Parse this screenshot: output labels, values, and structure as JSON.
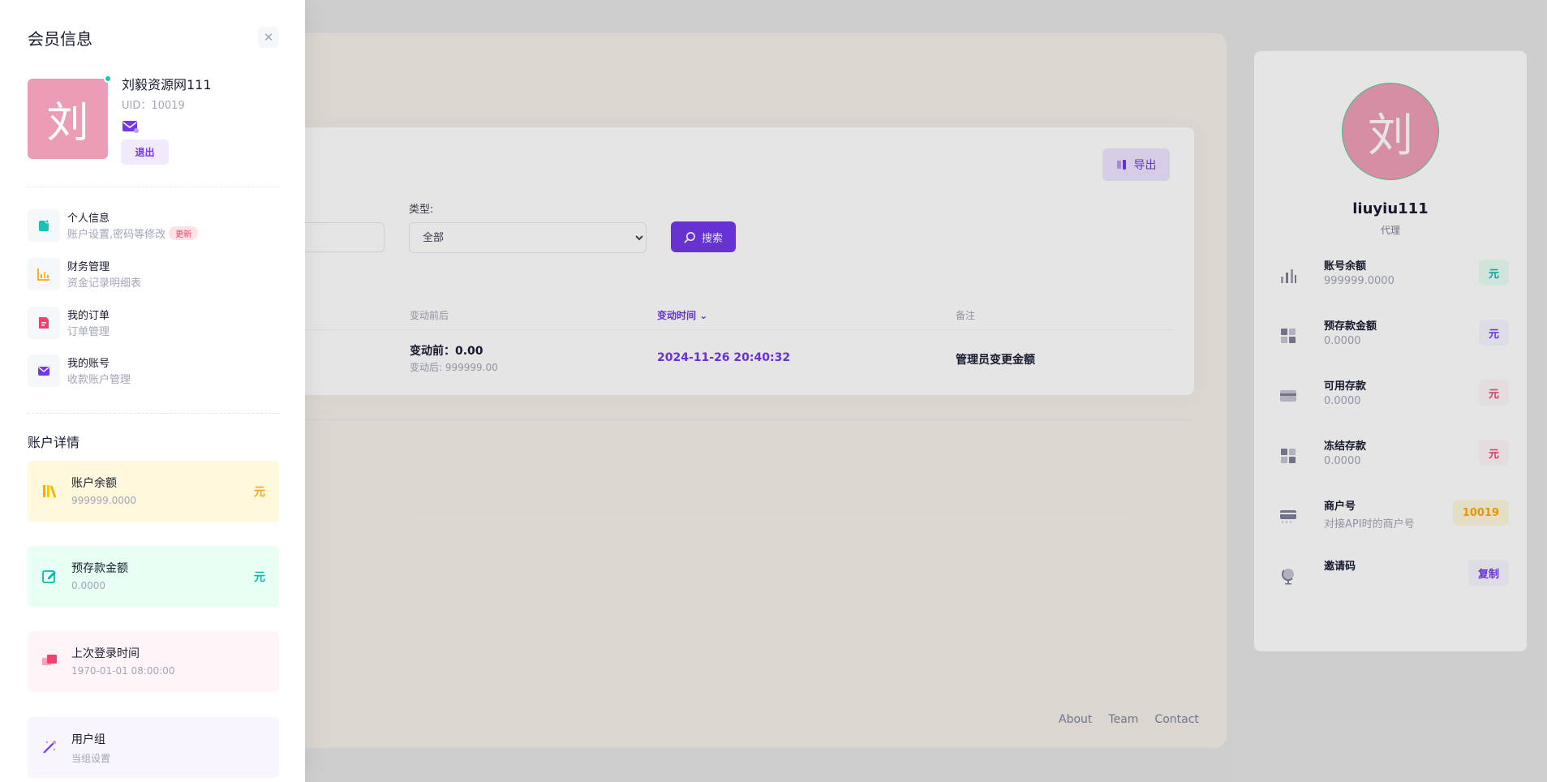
{
  "background": {
    "export_label": "导出",
    "type_label": "类型:",
    "type_selected": "全部",
    "search_label": "搜索",
    "table": {
      "headers": [
        "变动前后",
        "变动时间",
        "备注"
      ],
      "row": {
        "before_main": "变动前：0.00",
        "before_sub": "变动后: 999999.00",
        "time": "2024-11-26 20:40:32",
        "note": "管理员变更金额"
      }
    },
    "footer_links": [
      "About",
      "Team",
      "Contact"
    ]
  },
  "right_panel": {
    "avatar_char": "刘",
    "name": "liuyiu111",
    "role": "代理",
    "items": [
      {
        "title": "账号余额",
        "sub": "999999.0000",
        "badge": "元",
        "icon": "bar-chart-icon"
      },
      {
        "title": "预存款金额",
        "sub": "0.0000",
        "badge": "元",
        "icon": "grid-icon"
      },
      {
        "title": "可用存款",
        "sub": "0.0000",
        "badge": "元",
        "icon": "credit-card-icon"
      },
      {
        "title": "冻结存款",
        "sub": "0.0000",
        "badge": "元",
        "icon": "grid-icon"
      },
      {
        "title": "商户号",
        "sub": "对接API时的商户号",
        "badge": "10019",
        "icon": "card-icon"
      },
      {
        "title": "邀请码",
        "sub": "",
        "badge": "复制",
        "icon": "globe-icon"
      }
    ],
    "colors": {
      "teal_bg": "#e8fff3",
      "teal_fg": "#0bb7af",
      "purple_bg": "#f8f5ff",
      "purple_fg": "#7239ea",
      "red_bg": "#fff5f8",
      "red_fg": "#f1416c",
      "orange_bg": "#fff8dd",
      "orange_fg": "#ffa800"
    }
  },
  "drawer": {
    "title": "会员信息",
    "avatar_char": "刘",
    "username": "刘毅资源网111",
    "uid": "UID：10019",
    "logout_label": "退出",
    "menu": [
      {
        "title": "个人信息",
        "sub": "账户设置,密码等修改",
        "badge": "更新",
        "icon": "profile-icon"
      },
      {
        "title": "财务管理",
        "sub": "资金记录明细表",
        "icon": "chart-icon"
      },
      {
        "title": "我的订单",
        "sub": "订单管理",
        "icon": "order-icon"
      },
      {
        "title": "我的账号",
        "sub": "收款账户管理",
        "icon": "mail-icon"
      }
    ],
    "section_title": "账户详情",
    "stats": [
      {
        "title": "账户余额",
        "sub": "999999.0000",
        "unit": "元",
        "icon": "books-icon",
        "bg": "#fff8dd",
        "fg": "#ffa800"
      },
      {
        "title": "预存款金额",
        "sub": "0.0000",
        "unit": "元",
        "icon": "edit-icon",
        "bg": "#e8fff3",
        "fg": "#0bb7af"
      },
      {
        "title": "上次登录时间",
        "sub": "1970-01-01 08:00:00",
        "unit": "",
        "icon": "chat-icon",
        "bg": "#fff5f8",
        "fg": "#f1416c"
      },
      {
        "title": "用户组",
        "sub": "当组设置",
        "unit": "",
        "icon": "magic-icon",
        "bg": "#f8f5ff",
        "fg": "#7239ea"
      }
    ]
  }
}
